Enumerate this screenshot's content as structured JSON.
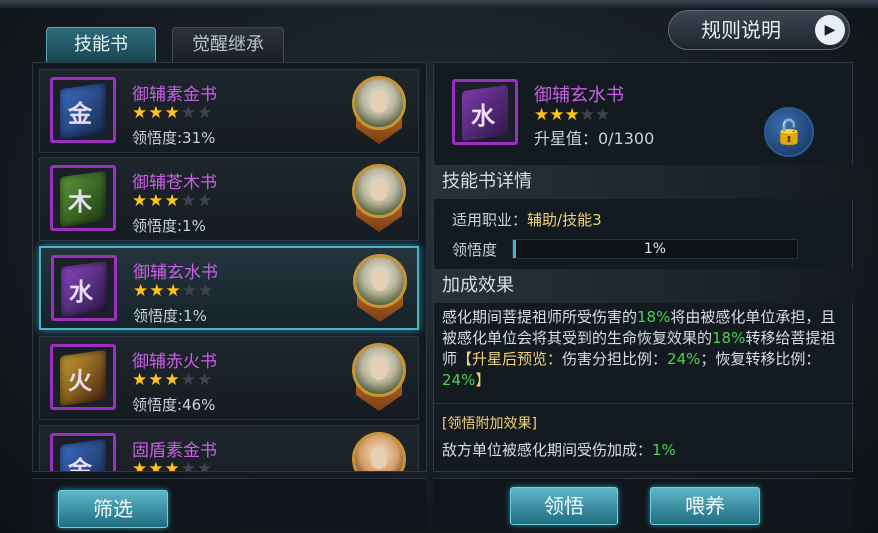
{
  "tabs": {
    "skill_books": "技能书",
    "awaken_inherit": "觉醒继承"
  },
  "rules_button": {
    "label": "规则说明",
    "arrow": "▶"
  },
  "book_list": [
    {
      "name": "御辅素金书",
      "stars_on": "★★★",
      "stars_off": "★★",
      "comprehension": "领悟度:31%",
      "cover_color": "#2f56a3",
      "glyph": "金"
    },
    {
      "name": "御辅苍木书",
      "stars_on": "★★★",
      "stars_off": "★★",
      "comprehension": "领悟度:1%",
      "cover_color": "#3b7a2a",
      "glyph": "木"
    },
    {
      "name": "御辅玄水书",
      "stars_on": "★★★",
      "stars_off": "★★",
      "comprehension": "领悟度:1%",
      "cover_color": "#6a2fa0",
      "glyph": "水"
    },
    {
      "name": "御辅赤火书",
      "stars_on": "★★★",
      "stars_off": "★★",
      "comprehension": "领悟度:46%",
      "cover_color": "#a0431e",
      "glyph": "火"
    },
    {
      "name": "固盾素金书",
      "stars_on": "★★★",
      "stars_off": "★★",
      "comprehension": "",
      "cover_color": "#2f56a3",
      "glyph": "金"
    }
  ],
  "filter_button": "筛选",
  "detail": {
    "name": "御辅玄水书",
    "stars_on": "★★★",
    "stars_off": "★★",
    "upgrade_value": "升星值：0/1300",
    "lock_icon": "🔓",
    "section_details": "技能书详情",
    "job_label": "适用职业：",
    "job_value": "辅助/技能3",
    "comprehension_label": "领悟度",
    "comprehension_pct": "1%",
    "comprehension_fraction": 0.01,
    "section_bonus": "加成效果",
    "effect_1": "感化期间菩提祖师所受伤害的",
    "effect_pct1": "18%",
    "effect_2": "将由被感化单位承担，且被感化单位会将其受到的生命恢复效果的",
    "effect_pct2": "18%",
    "effect_3": "转移给菩提祖师",
    "preview_open": "【升星后预览：",
    "preview_1": "伤害分担比例：",
    "preview_pct1": "24%",
    "preview_2": "；恢复转移比例：",
    "preview_pct2": "24%",
    "preview_close": "】",
    "extra_title": "[领悟附加效果]",
    "extra_text": "敌方单位被感化期间受伤加成：",
    "extra_pct": "1%"
  },
  "buttons": {
    "study": "领悟",
    "feed": "喂养"
  }
}
